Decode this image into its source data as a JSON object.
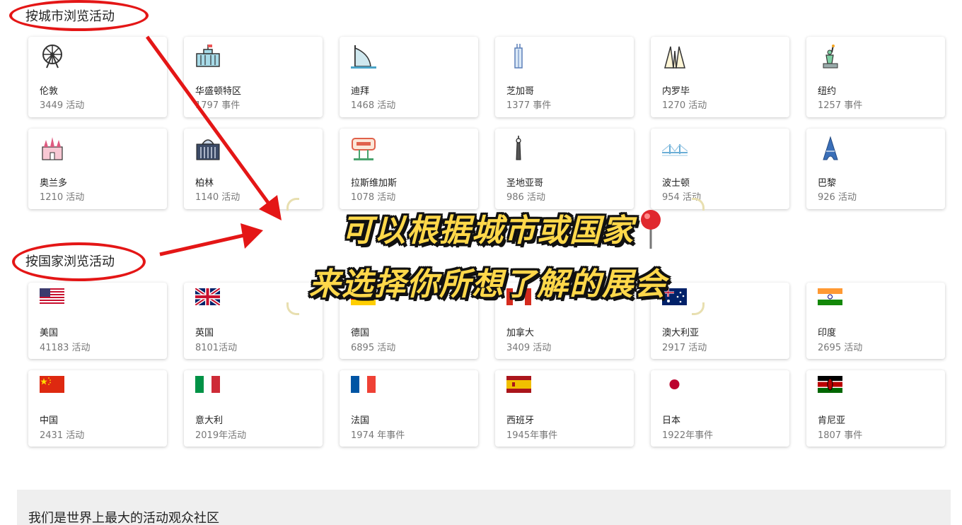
{
  "city_section": {
    "heading": "按城市浏览活动",
    "items": [
      {
        "label": "伦敦",
        "count": "3449 活动",
        "icon": "ferris-wheel-icon"
      },
      {
        "label": "华盛顿特区",
        "count": "1797 事件",
        "icon": "white-house-icon"
      },
      {
        "label": "迪拜",
        "count": "1468 活动",
        "icon": "burj-al-arab-icon"
      },
      {
        "label": "芝加哥",
        "count": "1377 事件",
        "icon": "skyscraper-icon"
      },
      {
        "label": "内罗毕",
        "count": "1270 活动",
        "icon": "monument-icon"
      },
      {
        "label": "纽约",
        "count": "1257 事件",
        "icon": "statue-of-liberty-icon"
      },
      {
        "label": "奥兰多",
        "count": "1210 活动",
        "icon": "castle-icon"
      },
      {
        "label": "柏林",
        "count": "1140 活动",
        "icon": "reichstag-icon"
      },
      {
        "label": "拉斯维加斯",
        "count": "1078 活动",
        "icon": "las-vegas-sign-icon"
      },
      {
        "label": "圣地亚哥",
        "count": "986 活动",
        "icon": "tower-icon"
      },
      {
        "label": "波士顿",
        "count": "954 活动",
        "icon": "bridge-icon"
      },
      {
        "label": "巴黎",
        "count": "926 活动",
        "icon": "eiffel-tower-icon"
      }
    ]
  },
  "country_section": {
    "heading": "按国家浏览活动",
    "items": [
      {
        "label": "美国",
        "count": "41183 活动",
        "icon": "flag-usa-icon"
      },
      {
        "label": "英国",
        "count": "8101活动",
        "icon": "flag-uk-icon"
      },
      {
        "label": "德国",
        "count": "6895 活动",
        "icon": "flag-germany-icon"
      },
      {
        "label": "加拿大",
        "count": "3409 活动",
        "icon": "flag-canada-icon"
      },
      {
        "label": "澳大利亚",
        "count": "2917 活动",
        "icon": "flag-australia-icon"
      },
      {
        "label": "印度",
        "count": "2695 活动",
        "icon": "flag-india-icon"
      },
      {
        "label": "中国",
        "count": "2431 活动",
        "icon": "flag-china-icon"
      },
      {
        "label": "意大利",
        "count": "2019年活动",
        "icon": "flag-italy-icon"
      },
      {
        "label": "法国",
        "count": "1974 年事件",
        "icon": "flag-france-icon"
      },
      {
        "label": "西班牙",
        "count": "1945年事件",
        "icon": "flag-spain-icon"
      },
      {
        "label": "日本",
        "count": "1922年事件",
        "icon": "flag-japan-icon"
      },
      {
        "label": "肯尼亚",
        "count": "1807 事件",
        "icon": "flag-kenya-icon"
      }
    ]
  },
  "overlay": {
    "line1": "可以根据城市或国家",
    "line2": "来选择你所想了解的展会"
  },
  "footer": {
    "text": "我们是世界上最大的活动观众社区"
  },
  "colors": {
    "annotation_red": "#e41616",
    "overlay_yellow": "#ffd84a",
    "footer_bg": "#efefef"
  }
}
